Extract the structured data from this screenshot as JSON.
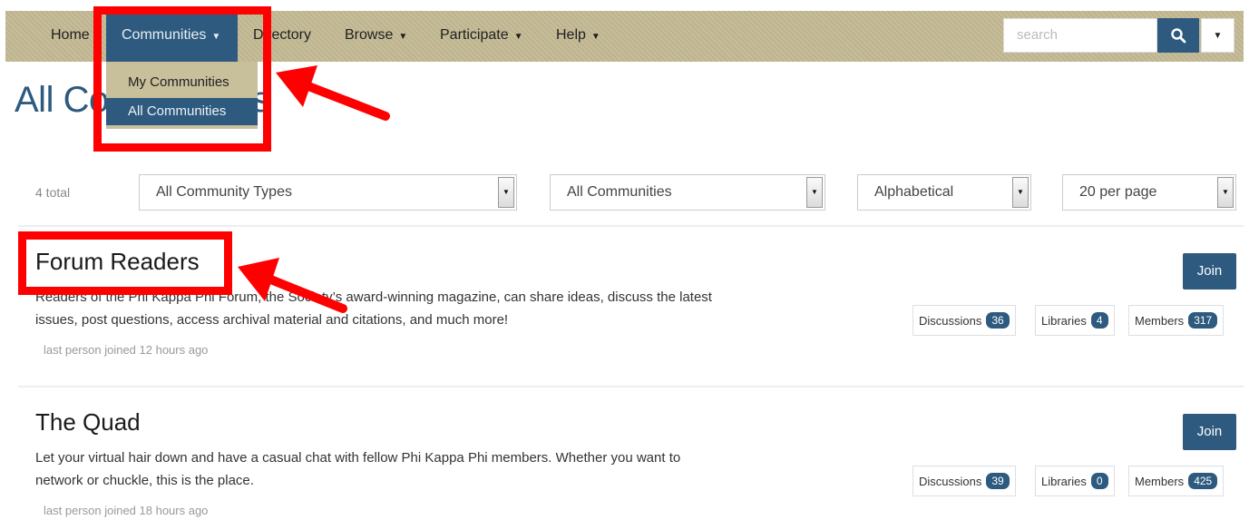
{
  "nav": {
    "items": [
      {
        "label": "Home",
        "caret": false
      },
      {
        "label": "Communities",
        "caret": true
      },
      {
        "label": "Directory",
        "caret": false
      },
      {
        "label": "Browse",
        "caret": true
      },
      {
        "label": "Participate",
        "caret": true
      },
      {
        "label": "Help",
        "caret": true
      }
    ],
    "search_placeholder": "search"
  },
  "dropdown": {
    "items": [
      "My Communities",
      "All Communities"
    ]
  },
  "page_title": "All Communities",
  "filters": {
    "total": "4 total",
    "type": "All Community Types",
    "scope": "All Communities",
    "sort": "Alphabetical",
    "per_page": "20 per page"
  },
  "communities": [
    {
      "title": "Forum Readers",
      "description": "Readers of the Phi Kappa Phi Forum, the Society’s award-winning magazine, can share ideas, discuss the latest issues, post questions, access archival material and citations, and much more!",
      "meta": "last person joined 12 hours ago",
      "join_label": "Join",
      "stats": {
        "discussions_label": "Discussions",
        "discussions": "36",
        "libraries_label": "Libraries",
        "libraries": "4",
        "members_label": "Members",
        "members": "317"
      }
    },
    {
      "title": "The Quad",
      "description": "Let your virtual hair down and have a casual chat with fellow Phi Kappa Phi members. Whether you want to network or chuckle, this is the place.",
      "meta": "last person joined 18 hours ago",
      "join_label": "Join",
      "stats": {
        "discussions_label": "Discussions",
        "discussions": "39",
        "libraries_label": "Libraries",
        "libraries": "0",
        "members_label": "Members",
        "members": "425"
      }
    }
  ],
  "colors": {
    "primary": "#2d5a7e",
    "navbar": "#c2b994",
    "annotation": "#ff0000"
  },
  "icons": {
    "search": "search-icon",
    "caret": "caret-down-icon"
  }
}
